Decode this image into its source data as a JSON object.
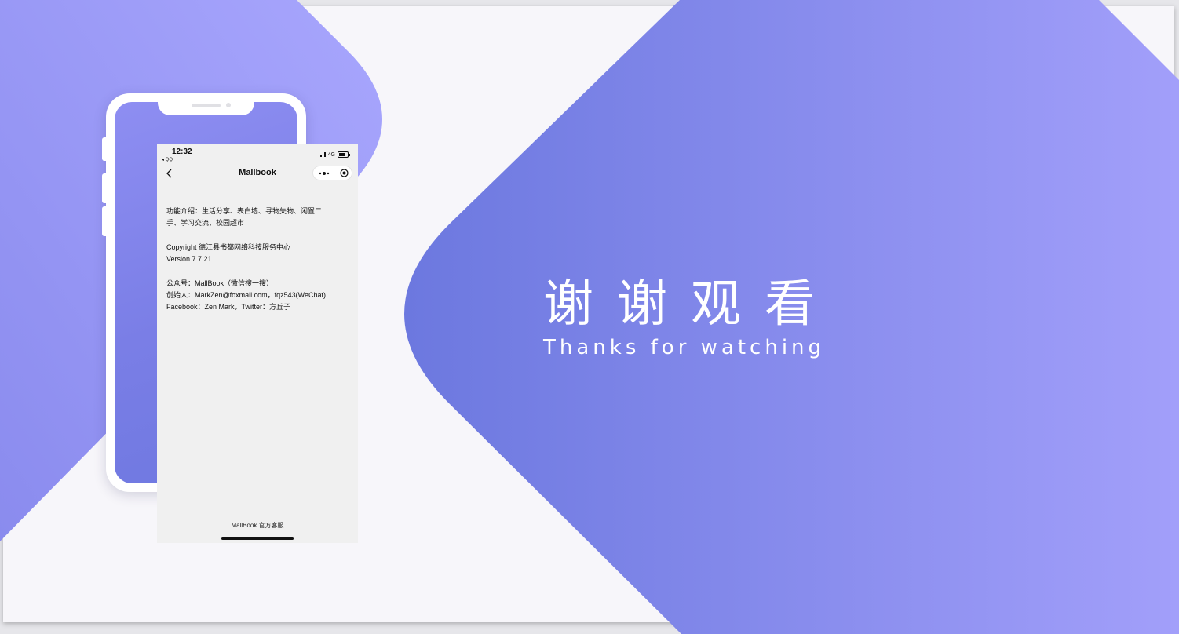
{
  "phone_app": {
    "status_bar": {
      "time": "12:32",
      "back_app": "◂ QQ",
      "network": "4G"
    },
    "nav": {
      "title": "Mallbook"
    },
    "info": {
      "intro_line1": "功能介绍：生活分享、表白墙、寻物失物、闲置二",
      "intro_line2": "手、学习交流、校园超市",
      "copyright": "Copyright 德江县书都网络科技服务中心",
      "version": "Version 7.7.21",
      "public_account": "公众号：MallBook（微信搜一搜）",
      "founder": "创始人：MarkZen@foxmail.com，fqz543(WeChat)",
      "social": "Facebook：Zen Mark，Twitter：方丘子"
    },
    "footer_link": "MallBook 官方客服"
  },
  "slide": {
    "title_cn": "谢谢观看",
    "title_en": "Thanks for watching"
  },
  "colors": {
    "accent_dark": "#6e78e0",
    "accent_light": "#a3a2fb",
    "slide_bg": "#f7f6fa"
  }
}
